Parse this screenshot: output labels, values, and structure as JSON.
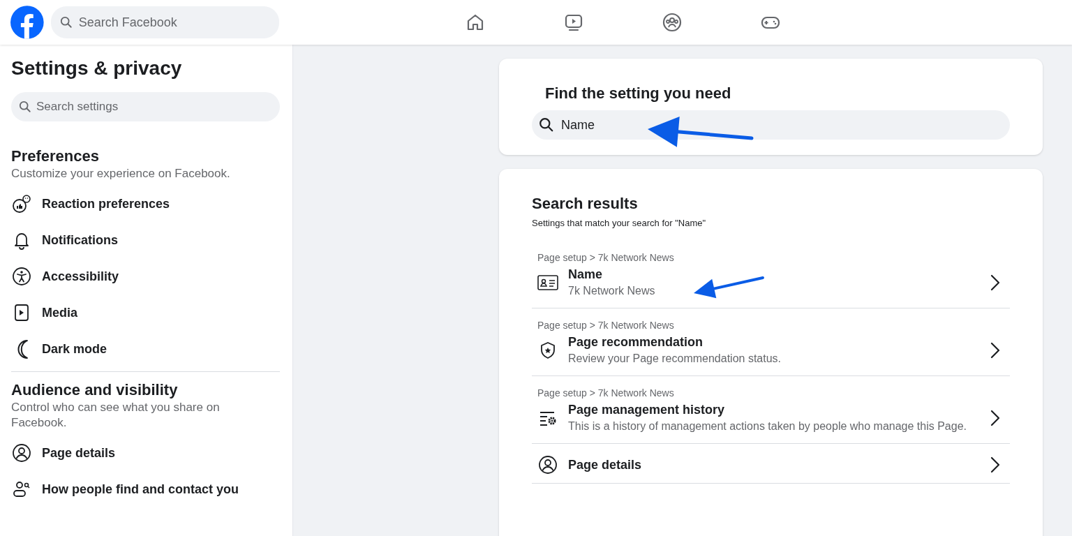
{
  "topbar": {
    "search": {
      "placeholder": "Search Facebook"
    },
    "nav": [
      {
        "kind": "home"
      },
      {
        "kind": "video"
      },
      {
        "kind": "groups"
      },
      {
        "kind": "gaming"
      }
    ]
  },
  "sidebar": {
    "title": "Settings & privacy",
    "search": {
      "placeholder": "Search settings"
    },
    "sections": [
      {
        "title": "Preferences",
        "subtitle": "Customize your experience on Facebook.",
        "items": [
          {
            "label": "Reaction preferences",
            "kind": "reaction"
          },
          {
            "label": "Notifications",
            "kind": "bell"
          },
          {
            "label": "Accessibility",
            "kind": "accessibility"
          },
          {
            "label": "Media",
            "kind": "media"
          },
          {
            "label": "Dark mode",
            "kind": "moon"
          }
        ]
      },
      {
        "title": "Audience and visibility",
        "subtitle": "Control who can see what you share on Facebook.",
        "items": [
          {
            "label": "Page details",
            "kind": "person"
          },
          {
            "label": "How people find and contact you",
            "kind": "people-search"
          }
        ]
      }
    ]
  },
  "find_card": {
    "title": "Find the setting you need",
    "search": {
      "value": "Name"
    }
  },
  "results": {
    "title": "Search results",
    "subtitle": "Settings that match your search for \"Name\"",
    "rows": [
      {
        "breadcrumb": "Page setup > 7k Network News",
        "title": "Name",
        "description": "7k Network News",
        "kind": "id-card"
      },
      {
        "breadcrumb": "Page setup > 7k Network News",
        "title": "Page recommendation",
        "description": "Review your Page recommendation status.",
        "kind": "shield"
      },
      {
        "breadcrumb": "Page setup > 7k Network News",
        "title": "Page management history",
        "description": "This is a history of management actions taken by people who manage this Page.",
        "kind": "list-gear"
      },
      {
        "title": "Page details",
        "kind": "person"
      }
    ]
  },
  "annotations": [
    {
      "kind": "arrow"
    },
    {
      "kind": "arrow"
    }
  ]
}
